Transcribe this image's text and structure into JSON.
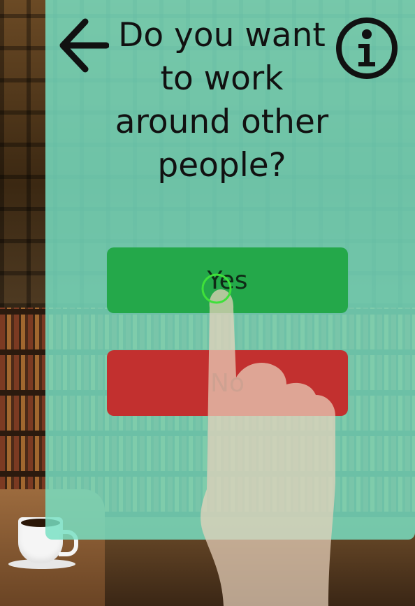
{
  "header": {
    "back_icon": "arrow-left-icon",
    "info_icon": "info-icon",
    "question": "Do you want to work around other people?"
  },
  "answers": {
    "yes_label": "Yes",
    "no_label": "No"
  },
  "colors": {
    "overlay": "#78e0c4",
    "yes": "#24a84a",
    "no": "#c2302f",
    "tap_indicator": "#3fe03a"
  }
}
